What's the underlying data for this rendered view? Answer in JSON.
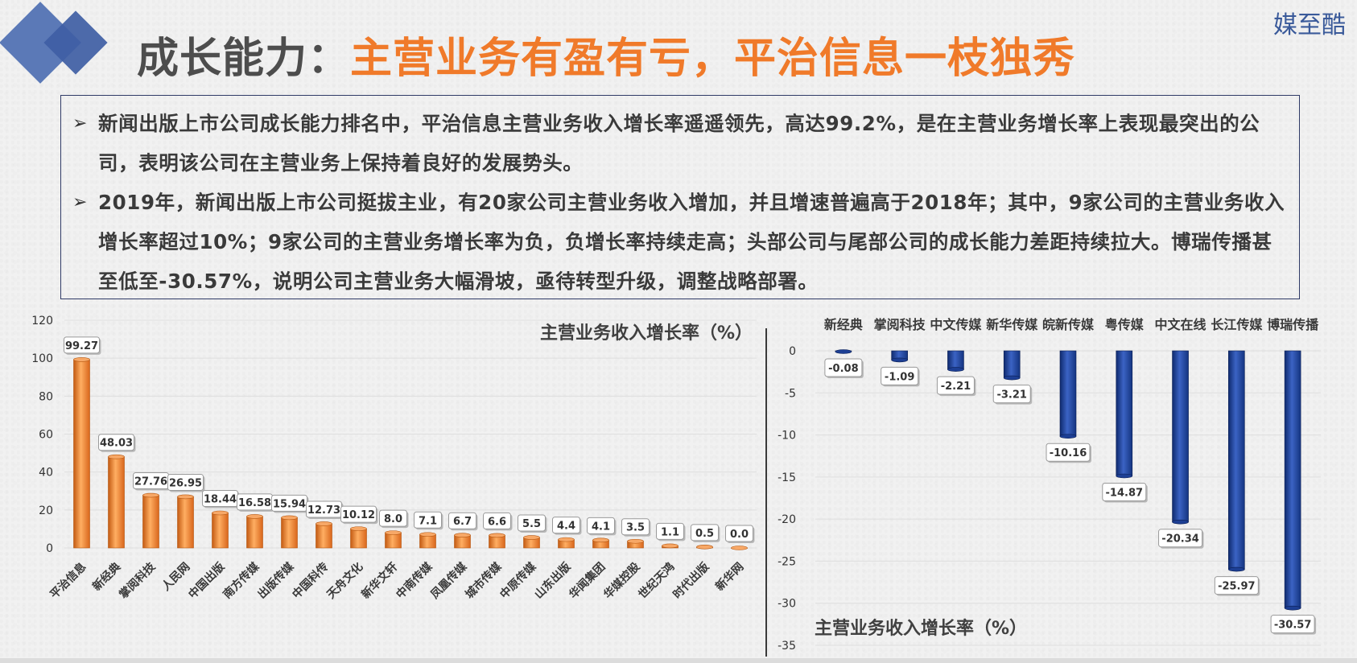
{
  "header": {
    "title_prefix": "成长能力：",
    "title_main": "主营业务有盈有亏，平治信息一枝独秀",
    "logo_text": "媒至酷"
  },
  "bullets": [
    "新闻出版上市公司成长能力排名中，平治信息主营业务收入增长率遥遥领先，高达99.2%，是在主营业务增长率上表现最突出的公司，表明该公司在主营业务上保持着良好的发展势头。",
    "2019年，新闻出版上市公司挺拔主业，有20家公司主营业务收入增加，并且增速普遍高于2018年；其中，9家公司的主营业务收入增长率超过10%；9家公司的主营业务增长率为负，负增长率持续走高；头部公司与尾部公司的成长能力差距持续拉大。博瑞传播甚至低至-30.57%，说明公司主营业务大幅滑坡，亟待转型升级，调整战略部署。"
  ],
  "colors": {
    "title_accent": "#f07a2a",
    "title_dark": "#4d4d4d",
    "positive_bar": "#f08a3a",
    "negative_bar": "#1f3f8f",
    "box_border": "#2f3a66"
  },
  "chart_data": [
    {
      "type": "bar",
      "title": "主营业务收入增长率（%）",
      "categories": [
        "平治信息",
        "新经典",
        "掌阅科技",
        "人民网",
        "中国出版",
        "南方传媒",
        "出版传媒",
        "中国科传",
        "天舟文化",
        "新华文轩",
        "中南传媒",
        "凤凰传媒",
        "城市传媒",
        "中原传媒",
        "山东出版",
        "华闻集团",
        "华媒控股",
        "世纪天鸿",
        "时代出版",
        "新华网"
      ],
      "values": [
        99.27,
        48.03,
        27.76,
        26.95,
        18.44,
        16.58,
        15.94,
        12.73,
        10.12,
        8.0,
        7.1,
        6.7,
        6.6,
        5.5,
        4.4,
        4.1,
        3.5,
        1.1,
        0.5,
        0.0
      ],
      "value_labels": [
        "99.27",
        "48.03",
        "27.76",
        "26.95",
        "18.44",
        "16.58",
        "15.94",
        "12.73",
        "10.12",
        "8.0",
        "7.1",
        "6.7",
        "6.6",
        "5.5",
        "4.4",
        "4.1",
        "3.5",
        "1.1",
        "0.5",
        "0.0"
      ],
      "ylim": [
        0,
        120
      ],
      "yticks": [
        "0",
        "20",
        "40",
        "60",
        "80",
        "100",
        "120"
      ],
      "grid": true,
      "title_position": "top-right"
    },
    {
      "type": "bar",
      "title": "主营业务收入增长率（%）",
      "categories": [
        "新经典",
        "掌阅科技",
        "中文传媒",
        "新华传媒",
        "皖新传媒",
        "粤传媒",
        "中文在线",
        "长江传媒",
        "博瑞传播"
      ],
      "values": [
        -0.08,
        -1.09,
        -2.21,
        -3.21,
        -10.16,
        -14.87,
        -20.34,
        -25.97,
        -30.57
      ],
      "value_labels": [
        "-0.08",
        "-1.09",
        "-2.21",
        "-3.21",
        "-10.16",
        "-14.87",
        "-20.34",
        "-25.97",
        "-30.57"
      ],
      "ylim": [
        -35,
        0
      ],
      "yticks": [
        "0",
        "-5",
        "-10",
        "-15",
        "-20",
        "-25",
        "-30",
        "-35"
      ],
      "grid": true,
      "title_position": "bottom-left"
    }
  ]
}
